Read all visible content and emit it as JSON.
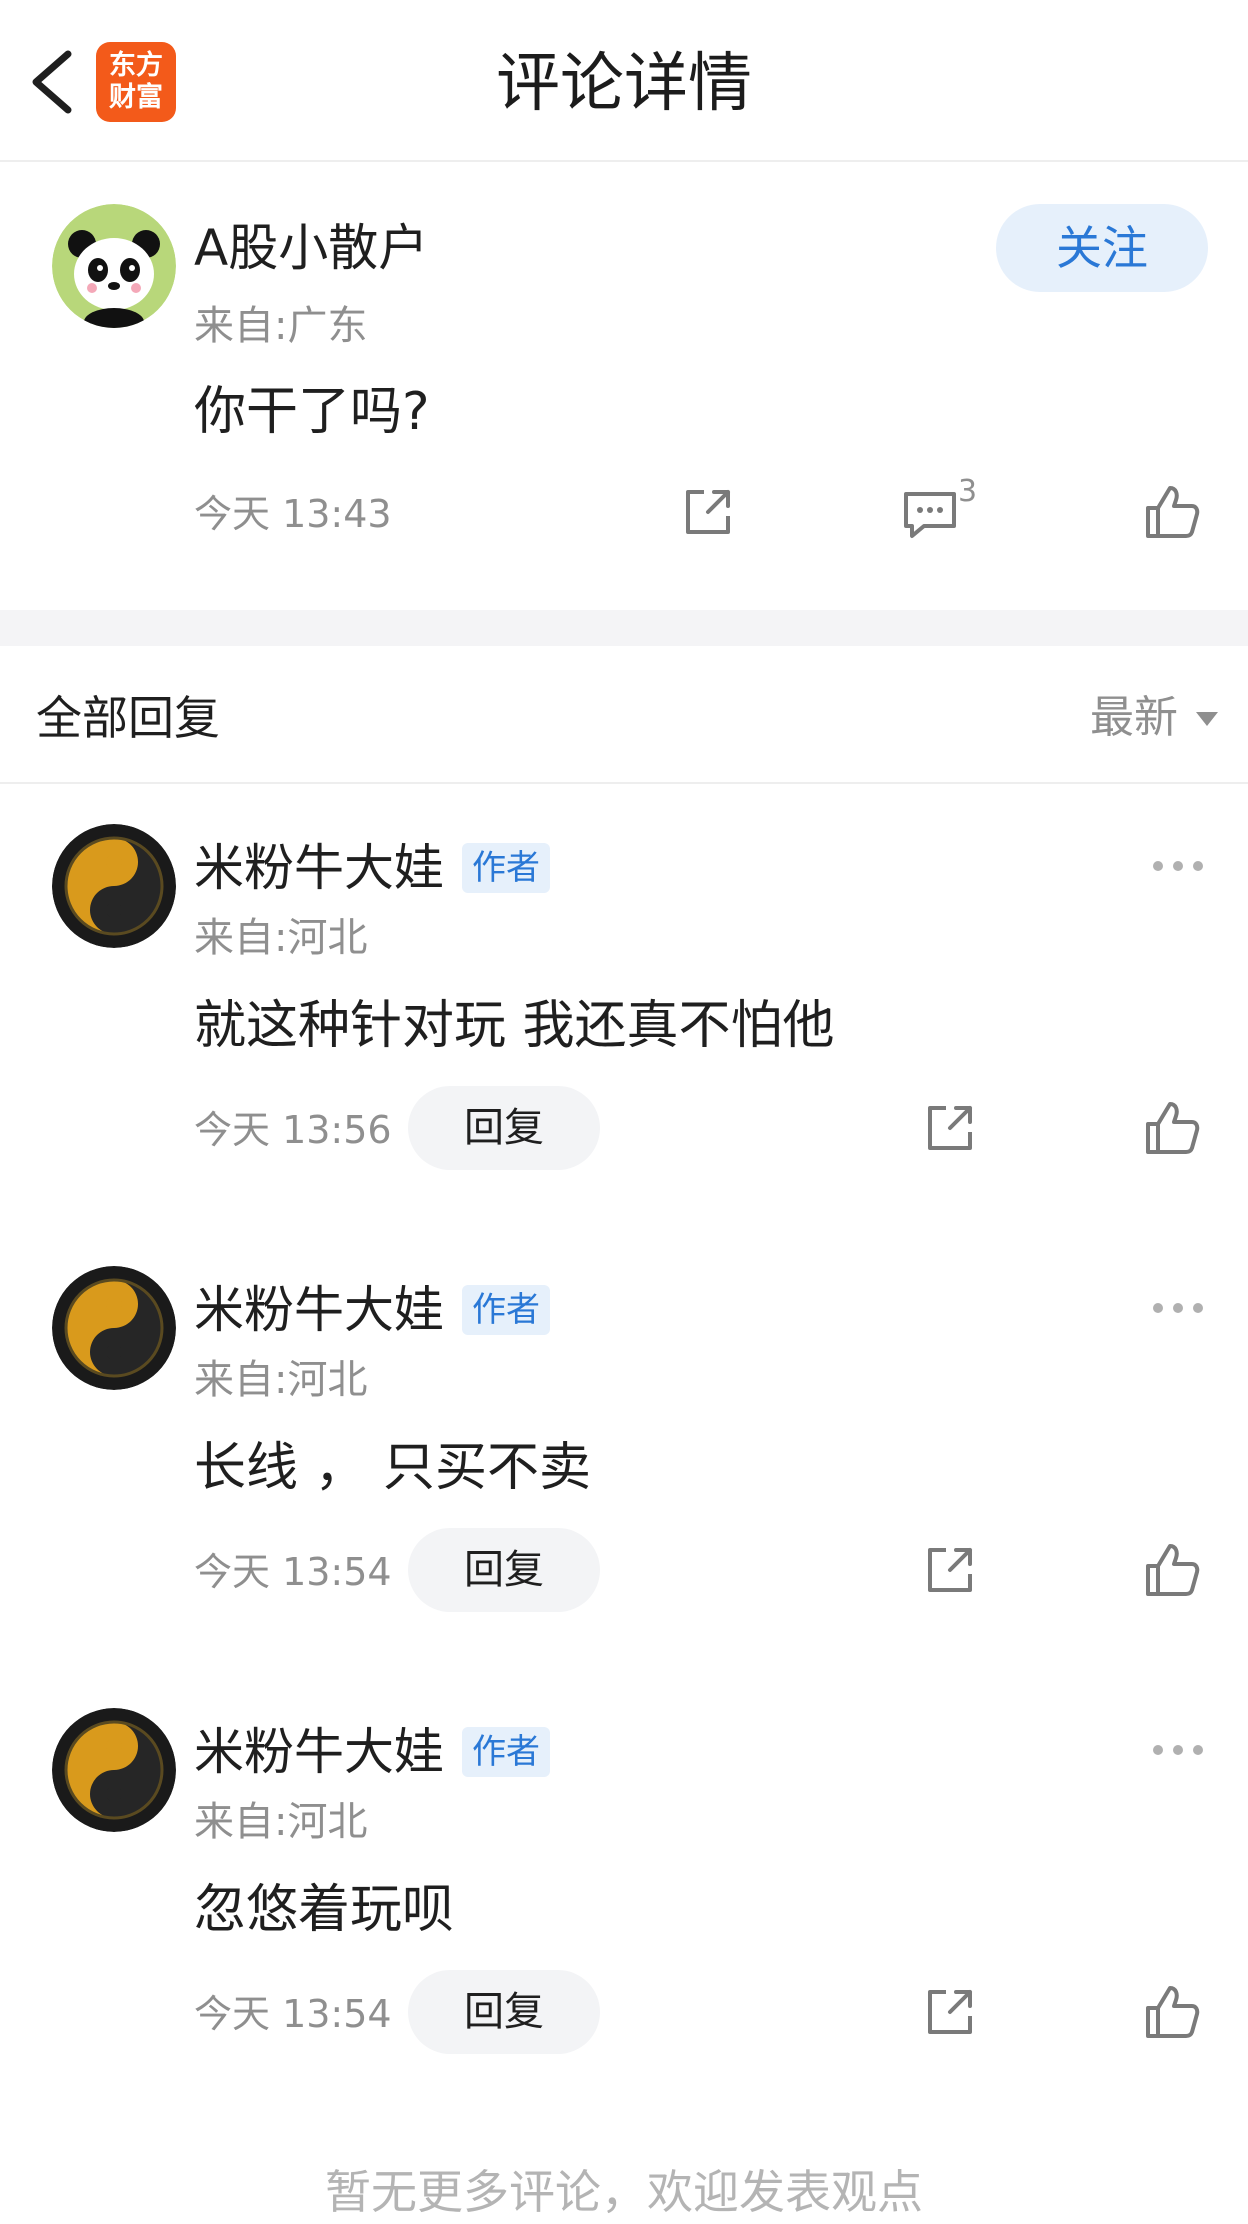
{
  "header": {
    "title": "评论详情",
    "logo_line1": "东方",
    "logo_line2": "财富",
    "back_icon": "chevron-left-icon"
  },
  "post": {
    "username": "A股小散户",
    "location": "来自:广东",
    "content": "你干了吗?",
    "time": "今天 13:43",
    "follow_label": "关注",
    "comment_count": "3",
    "avatar_icon": "panda-avatar"
  },
  "replies_section": {
    "title": "全部回复",
    "sort_label": "最新",
    "sort_icon": "caret-down-icon"
  },
  "replies": [
    {
      "username": "米粉牛大娃",
      "tag": "作者",
      "location": "来自:河北",
      "content": "就这种针对玩 我还真不怕他",
      "time": "今天 13:56",
      "reply_label": "回复"
    },
    {
      "username": "米粉牛大娃",
      "tag": "作者",
      "location": "来自:河北",
      "content": "长线 ， 只买不卖",
      "time": "今天 13:54",
      "reply_label": "回复"
    },
    {
      "username": "米粉牛大娃",
      "tag": "作者",
      "location": "来自:河北",
      "content": "忽悠着玩呗",
      "time": "今天 13:54",
      "reply_label": "回复"
    }
  ],
  "footer": {
    "text": "暂无更多评论，欢迎发表观点"
  },
  "colors": {
    "accent_blue": "#2a78d6",
    "logo_orange": "#f35a1a",
    "secondary_text": "#8f8f8f",
    "panel_bg": "#f3f4f6"
  }
}
